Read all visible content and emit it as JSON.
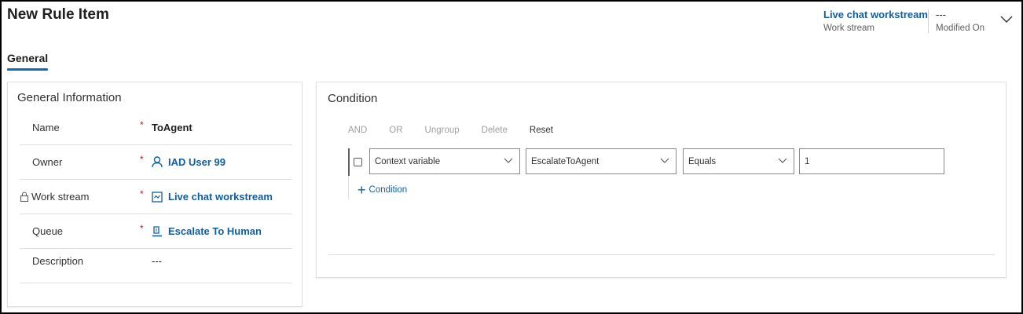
{
  "header": {
    "title": "New Rule Item",
    "work_stream_value": "Live chat workstream",
    "work_stream_label": "Work stream",
    "modified_value": "---",
    "modified_label": "Modified On"
  },
  "tabs": [
    {
      "label": "General",
      "selected": true
    }
  ],
  "general": {
    "section_title": "General Information",
    "fields": [
      {
        "label": "Name",
        "required": "*",
        "value": "ToAgent"
      },
      {
        "label": "Owner",
        "required": "*",
        "value": "IAD User 99",
        "icon": "person-icon"
      },
      {
        "label": "Work stream",
        "required": "*",
        "value": "Live chat workstream",
        "icon": "workstream-icon",
        "locked": true
      },
      {
        "label": "Queue",
        "required": "*",
        "value": "Escalate To Human",
        "icon": "queue-icon"
      },
      {
        "label": "Description",
        "value": "---"
      }
    ]
  },
  "condition": {
    "section_title": "Condition",
    "actions": {
      "and": "AND",
      "or": "OR",
      "ungroup": "Ungroup",
      "delete": "Delete",
      "reset": "Reset"
    },
    "row": {
      "type": "Context variable",
      "variable": "EscalateToAgent",
      "operator": "Equals",
      "value": "1"
    },
    "add_label": "Condition"
  },
  "colors": {
    "accent": "#0f6cbd",
    "link": "#115ea3",
    "required": "#a4262c"
  }
}
